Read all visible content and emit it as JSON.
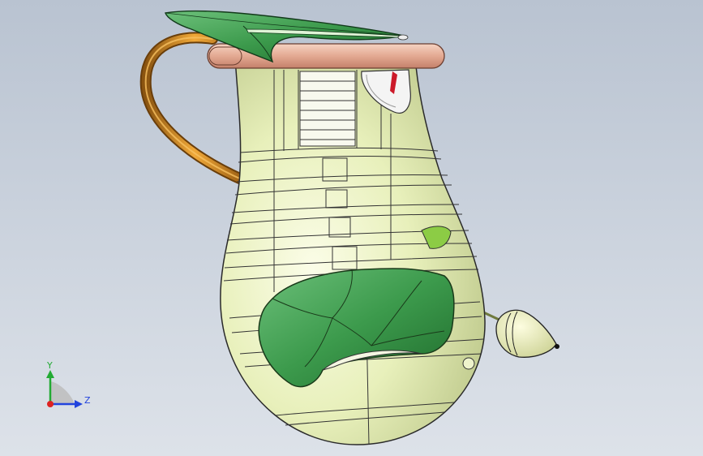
{
  "viewport": {
    "background_top": "#b9c3d1",
    "background_bottom": "#dde2e9"
  },
  "model": {
    "body_color": "#e6efb8",
    "leaf_color": "#3c9a4c",
    "handle_color": "#d08a1a",
    "rim_color": "#e9b6a0"
  },
  "triad": {
    "y_label": "Y",
    "z_label": "Z",
    "y_color": "#22aa33",
    "z_color": "#2244dd",
    "x_color": "#dd2222"
  }
}
